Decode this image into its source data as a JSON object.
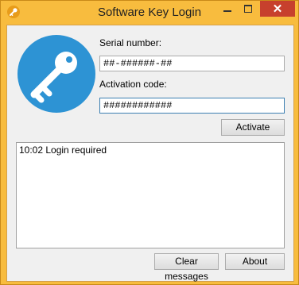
{
  "window": {
    "title": "Software Key Login"
  },
  "form": {
    "serial_label": "Serial number:",
    "serial_value": "##-######-##",
    "activation_label": "Activation code:",
    "activation_value": "############",
    "activate_button": "Activate"
  },
  "log": {
    "messages": [
      {
        "text": "10:02 Login required"
      }
    ]
  },
  "footer": {
    "clear_button": "Clear messages",
    "about_button": "About"
  },
  "colors": {
    "frame": "#f8bc3e",
    "close_button": "#c7402d",
    "logo_circle": "#2d93d4"
  },
  "icons": {
    "app": "key-icon",
    "logo": "key-icon"
  }
}
